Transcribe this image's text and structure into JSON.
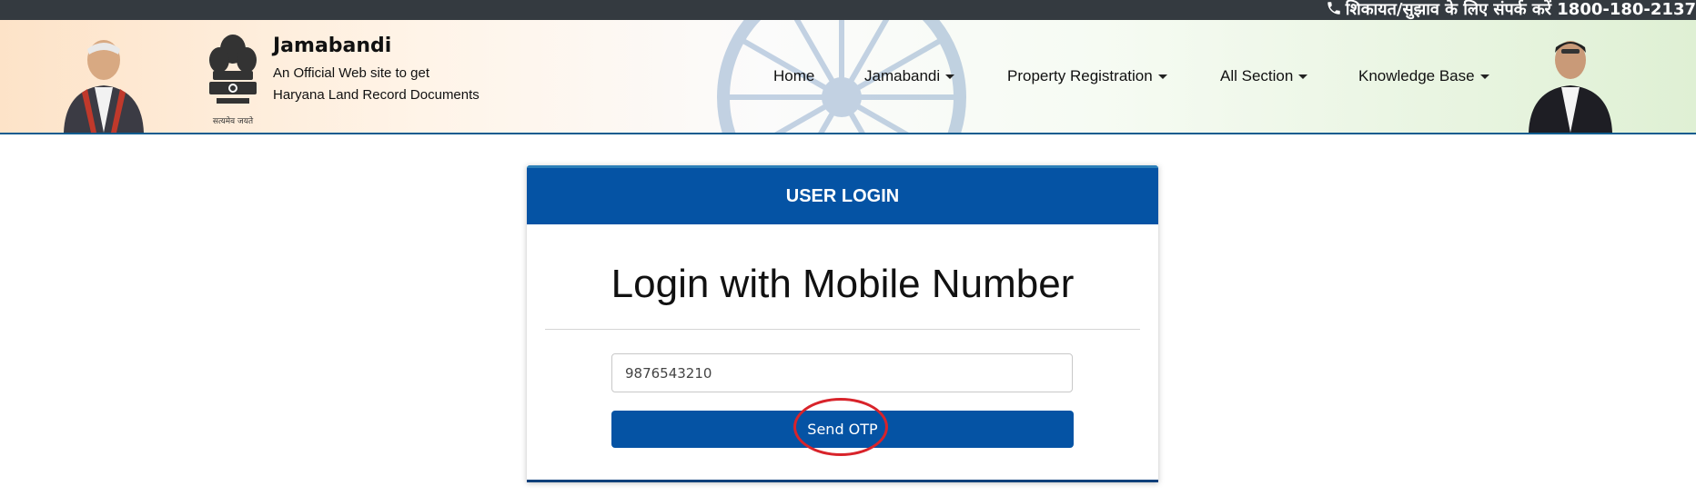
{
  "topbar": {
    "icon": "phone-icon",
    "helpline_text": "शिकायत/सुझाव के लिए संपर्क करें 1800-180-2137"
  },
  "header": {
    "site_title": "Jamabandi",
    "tagline_line1": "An Official Web site to get",
    "tagline_line2": "Haryana Land Record Documents",
    "emblem_motto": "सत्यमेव जयते"
  },
  "nav": {
    "items": [
      {
        "label": "Home",
        "has_dropdown": false
      },
      {
        "label": "Jamabandi",
        "has_dropdown": true
      },
      {
        "label": "Property Registration",
        "has_dropdown": true
      },
      {
        "label": "All Section",
        "has_dropdown": true
      },
      {
        "label": "Knowledge Base",
        "has_dropdown": true
      }
    ]
  },
  "login": {
    "card_title": "USER LOGIN",
    "heading": "Login with Mobile Number",
    "mobile_value": "9876543210",
    "send_otp_label": "Send OTP"
  },
  "colors": {
    "topbar_bg": "#343a40",
    "primary_blue": "#0553a4",
    "annotation_red": "#d8232a"
  }
}
